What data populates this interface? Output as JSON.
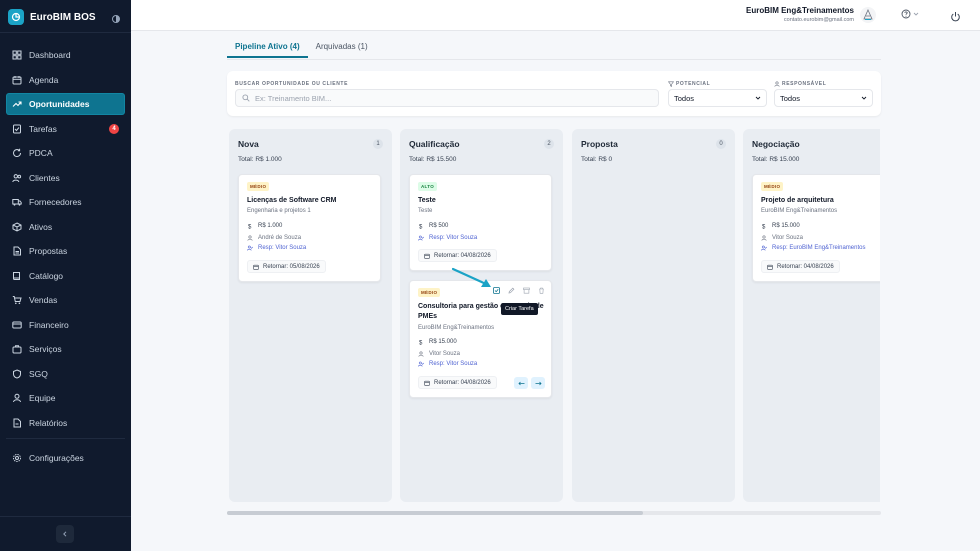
{
  "app": {
    "name": "EuroBIM BOS"
  },
  "sidebar": {
    "items": [
      {
        "label": "Dashboard",
        "icon": "grid-icon"
      },
      {
        "label": "Agenda",
        "icon": "calendar-icon"
      },
      {
        "label": "Oportunidades",
        "icon": "trending-up-icon",
        "active": true
      },
      {
        "label": "Tarefas",
        "icon": "checklist-icon",
        "badge": "4"
      },
      {
        "label": "PDCA",
        "icon": "refresh-icon"
      },
      {
        "label": "Clientes",
        "icon": "users-icon"
      },
      {
        "label": "Fornecedores",
        "icon": "truck-icon"
      },
      {
        "label": "Ativos",
        "icon": "box-icon"
      },
      {
        "label": "Propostas",
        "icon": "file-icon"
      },
      {
        "label": "Catálogo",
        "icon": "book-icon"
      },
      {
        "label": "Vendas",
        "icon": "cart-icon"
      },
      {
        "label": "Financeiro",
        "icon": "card-icon"
      },
      {
        "label": "Serviços",
        "icon": "briefcase-icon"
      },
      {
        "label": "SGQ",
        "icon": "shield-icon"
      },
      {
        "label": "Equipe",
        "icon": "user-icon"
      },
      {
        "label": "Relatórios",
        "icon": "report-icon"
      }
    ],
    "settings": {
      "label": "Configurações",
      "icon": "gear-icon"
    }
  },
  "header": {
    "user_name": "EuroBIM Eng&Treinamentos",
    "user_email": "contato.eurobim@gmail.com"
  },
  "tabs": [
    {
      "label": "Pipeline Ativo (4)",
      "active": true
    },
    {
      "label": "Arquivadas (1)",
      "active": false
    }
  ],
  "filters": {
    "search_label": "BUSCAR OPORTUNIDADE OU CLIENTE",
    "search_placeholder": "Ex: Treinamento BIM...",
    "potential_label": "POTENCIAL",
    "potential_value": "Todos",
    "responsible_label": "RESPONSÁVEL",
    "responsible_value": "Todos"
  },
  "columns": [
    {
      "title": "Nova",
      "count": "1",
      "total": "Total: R$ 1.000",
      "cards": [
        {
          "priority": "MÉDIO",
          "title": "Licenças de Software CRM",
          "client": "Engenharia e projetos 1",
          "value": "R$ 1.000",
          "contact": "André de Souza",
          "resp": "Resp: Vitor Souza",
          "return": "Retornar: 05/08/2026"
        }
      ]
    },
    {
      "title": "Qualificação",
      "count": "2",
      "total": "Total: R$ 15.500",
      "cards": [
        {
          "priority": "ALTO",
          "title": "Teste",
          "client": "Teste",
          "value": "R$ 500",
          "resp": "Resp: Vitor Souza",
          "return": "Retornar: 04/08/2026"
        },
        {
          "priority": "MÉDIO",
          "title": "Consultoria para gestão e controle de PMEs",
          "client": "EuroBIM Eng&Treinamentos",
          "value": "R$ 15.000",
          "contact": "Vitor Souza",
          "resp": "Resp: Vitor Souza",
          "return": "Retornar: 04/08/2026",
          "tooltip": "Criar Tarefa"
        }
      ]
    },
    {
      "title": "Proposta",
      "count": "0",
      "total": "Total: R$ 0",
      "cards": []
    },
    {
      "title": "Negociação",
      "count": "",
      "total": "Total: R$ 15.000",
      "cards": [
        {
          "priority": "MÉDIO",
          "title": "Projeto de arquitetura",
          "client": "EuroBIM Eng&Treinamentos",
          "value": "R$ 15.000",
          "contact": "Vitor Souza",
          "resp": "Resp: EuroBIM Eng&Treinamentos",
          "return": "Retornar: 04/08/2026"
        }
      ]
    }
  ],
  "colors": {
    "sidebar_bg": "#101a2d",
    "accent": "#0e7490",
    "brand": "#1ba3c6",
    "badge": "#ef4444"
  }
}
